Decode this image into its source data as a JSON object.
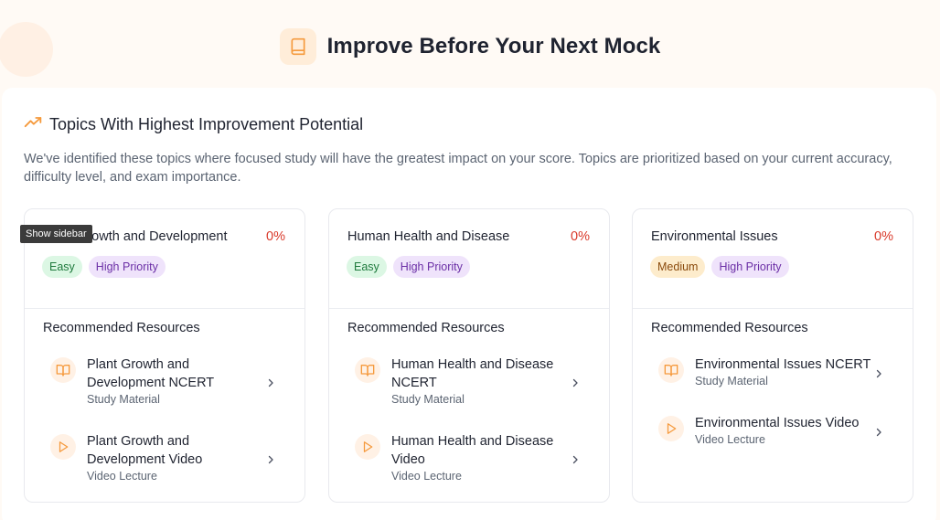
{
  "header": {
    "title": "Improve Before Your Next Mock",
    "icon": "book-icon"
  },
  "section": {
    "title": "Topics With Highest Improvement Potential",
    "icon": "trending-up-icon",
    "description": "We've identified these topics where focused study will have the greatest impact on your score. Topics are prioritized based on your current accuracy, difficulty level, and exam importance."
  },
  "tooltip": "Show sidebar",
  "colors": {
    "accent": "#f59a3d",
    "danger": "#d93a2b"
  },
  "cards": [
    {
      "title": "Plant Growth and Development",
      "percent": "0%",
      "difficulty": "Easy",
      "priority": "High Priority",
      "resources_heading": "Recommended Resources",
      "resources": [
        {
          "title": "Plant Growth and Development NCERT",
          "type": "Study Material",
          "icon": "book-open-icon"
        },
        {
          "title": "Plant Growth and Development Video",
          "type": "Video Lecture",
          "icon": "play-icon"
        }
      ]
    },
    {
      "title": "Human Health and Disease",
      "percent": "0%",
      "difficulty": "Easy",
      "priority": "High Priority",
      "resources_heading": "Recommended Resources",
      "resources": [
        {
          "title": "Human Health and Disease NCERT",
          "type": "Study Material",
          "icon": "book-open-icon"
        },
        {
          "title": "Human Health and Disease Video",
          "type": "Video Lecture",
          "icon": "play-icon"
        }
      ]
    },
    {
      "title": "Environmental Issues",
      "percent": "0%",
      "difficulty": "Medium",
      "priority": "High Priority",
      "resources_heading": "Recommended Resources",
      "resources": [
        {
          "title": "Environmental Issues NCERT",
          "type": "Study Material",
          "icon": "book-open-icon"
        },
        {
          "title": "Environmental Issues Video",
          "type": "Video Lecture",
          "icon": "play-icon"
        }
      ]
    }
  ]
}
